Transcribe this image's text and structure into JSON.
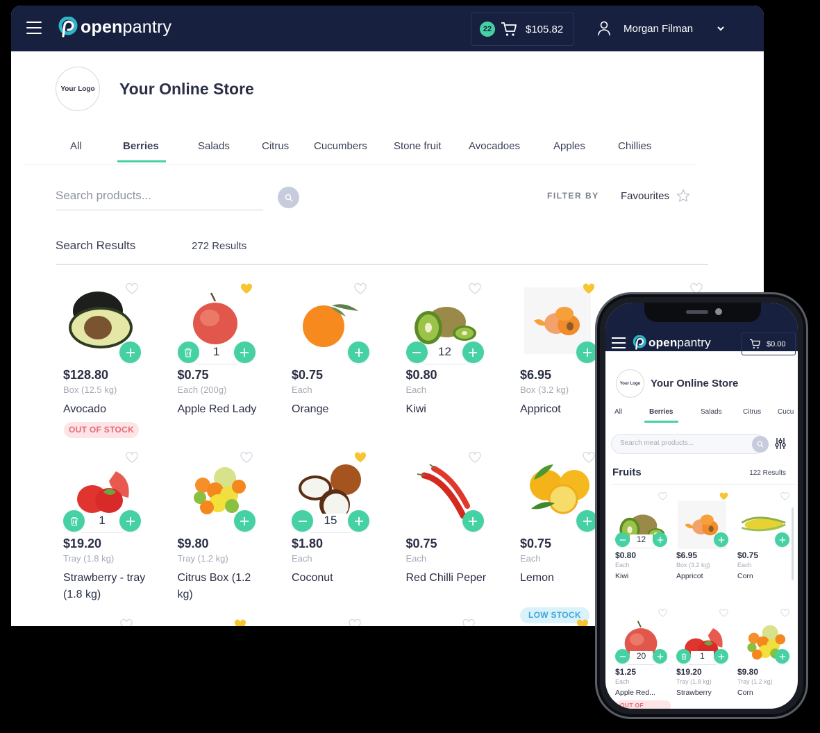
{
  "desktop": {
    "header": {
      "brand_bold": "open",
      "brand_light": "pantry",
      "cart_count": "22",
      "cart_total": "$105.82",
      "user_name": "Morgan Filman"
    },
    "store": {
      "logo_text": "Your Logo",
      "title": "Your Online Store"
    },
    "tabs": [
      {
        "label": "All",
        "active": false
      },
      {
        "label": "Berries",
        "active": true
      },
      {
        "label": "Salads",
        "active": false
      },
      {
        "label": "Citrus",
        "active": false
      },
      {
        "label": "Cucumbers",
        "active": false
      },
      {
        "label": "Stone fruit",
        "active": false
      },
      {
        "label": "Avocadoes",
        "active": false
      },
      {
        "label": "Apples",
        "active": false
      },
      {
        "label": "Chillies",
        "active": false
      }
    ],
    "search": {
      "placeholder": "Search products..."
    },
    "filter": {
      "label": "FILTER BY",
      "favourites_label": "Favourites"
    },
    "results": {
      "title": "Search Results",
      "count": "272 Results"
    },
    "products": [
      {
        "name": "Avocado",
        "price": "$128.80",
        "unit": "Box (12.5 kg)",
        "favourite": false,
        "qty": null,
        "badge": "OUT OF STOCK",
        "badge_type": "oos",
        "image": "avocado"
      },
      {
        "name": "Apple Red Lady",
        "price": "$0.75",
        "unit": "Each (200g)",
        "favourite": true,
        "qty": "1",
        "badge": null,
        "image": "apple"
      },
      {
        "name": "Orange",
        "price": "$0.75",
        "unit": "Each",
        "favourite": false,
        "qty": null,
        "badge": null,
        "image": "orange"
      },
      {
        "name": "Kiwi",
        "price": "$0.80",
        "unit": "Each",
        "favourite": false,
        "qty": "12",
        "badge": null,
        "image": "kiwi"
      },
      {
        "name": "Appricot",
        "price": "$6.95",
        "unit": "Box (3.2 kg)",
        "favourite": true,
        "qty": null,
        "badge": null,
        "image": "apricot"
      },
      {
        "name": "Strawberry - tray (1.8 kg)",
        "price": "$19.20",
        "unit": "Tray (1.8 kg)",
        "favourite": false,
        "qty": "1",
        "badge": null,
        "image": "strawberry"
      },
      {
        "name": "Citrus Box (1.2 kg)",
        "price": "$9.80",
        "unit": "Tray (1.2 kg)",
        "favourite": false,
        "qty": null,
        "badge": null,
        "image": "citrus"
      },
      {
        "name": "Coconut",
        "price": "$1.80",
        "unit": "Each",
        "favourite": true,
        "qty": "15",
        "badge": null,
        "image": "coconut"
      },
      {
        "name": "Red Chilli Peper",
        "price": "$0.75",
        "unit": "Each",
        "favourite": false,
        "qty": null,
        "badge": null,
        "image": "chilli"
      },
      {
        "name": "Lemon",
        "price": "$0.75",
        "unit": "Each",
        "favourite": false,
        "qty": null,
        "badge": "LOW STOCK",
        "badge_type": "low",
        "image": "lemon"
      }
    ]
  },
  "mobile": {
    "header": {
      "brand_bold": "open",
      "brand_light": "pantry",
      "cart_total": "$0.00"
    },
    "store": {
      "logo_text": "Your Logo",
      "title": "Your Online Store"
    },
    "tabs": [
      {
        "label": "All",
        "active": false
      },
      {
        "label": "Berries",
        "active": true
      },
      {
        "label": "Salads",
        "active": false
      },
      {
        "label": "Citrus",
        "active": false
      },
      {
        "label": "Cucu",
        "active": false
      }
    ],
    "search": {
      "placeholder": "Search meat products..."
    },
    "results": {
      "title": "Fruits",
      "count": "122 Results"
    },
    "products": [
      {
        "name": "Kiwi",
        "price": "$0.80",
        "unit": "Each",
        "favourite": false,
        "qty": "12",
        "image": "kiwi"
      },
      {
        "name": "Appricot",
        "price": "$6.95",
        "unit": "Box (3.2 kg)",
        "favourite": true,
        "qty": null,
        "image": "apricot"
      },
      {
        "name": "Corn",
        "price": "$0.75",
        "unit": "Each",
        "favourite": false,
        "qty": null,
        "image": "corn"
      },
      {
        "name": "Apple Red...",
        "price": "$1.25",
        "unit": "Each",
        "favourite": false,
        "qty": "20",
        "badge": "OUT OF STOCK",
        "badge_type": "oos",
        "image": "apple"
      },
      {
        "name": "Strawberry",
        "price": "$19.20",
        "unit": "Tray (1.8 kg)",
        "favourite": false,
        "qty": "1",
        "image": "strawberry"
      },
      {
        "name": "Corn",
        "price": "$9.80",
        "unit": "Tray (1.2 kg)",
        "favourite": false,
        "qty": null,
        "image": "citrus"
      }
    ]
  },
  "colors": {
    "navy": "#17213f",
    "accent": "#45d1a3",
    "favourite": "#f7c531",
    "out_of_stock": "#e66b76",
    "low_stock": "#3fa7d8"
  }
}
